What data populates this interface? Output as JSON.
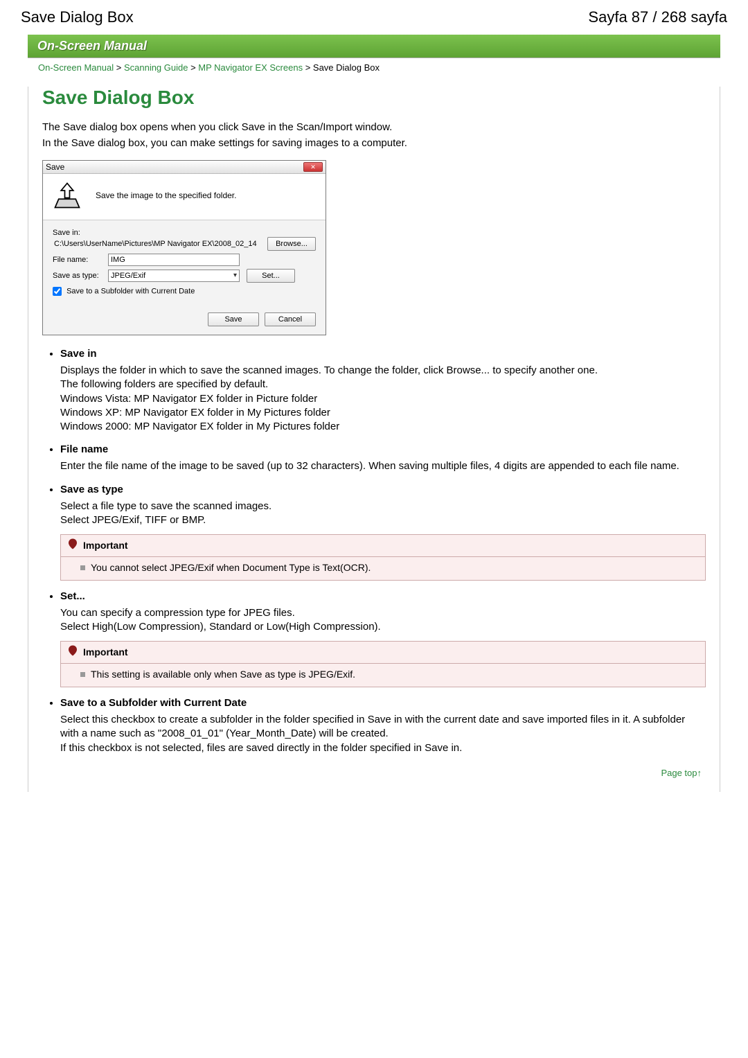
{
  "header": {
    "title_left": "Save Dialog Box",
    "title_right": "Sayfa 87 / 268 sayfa"
  },
  "strip": {
    "title": "On-Screen Manual"
  },
  "breadcrumb": {
    "a1": "On-Screen Manual",
    "a2": "Scanning Guide",
    "a3": "MP Navigator EX Screens",
    "current": "Save Dialog Box"
  },
  "page": {
    "h1": "Save Dialog Box",
    "intro1": "The Save dialog box opens when you click Save in the Scan/Import window.",
    "intro2": "In the Save dialog box, you can make settings for saving images to a computer."
  },
  "dialog": {
    "title": "Save",
    "close": "✕",
    "headline": "Save the image to the specified folder.",
    "savein_label": "Save in:",
    "savein_path": "C:\\Users\\UserName\\Pictures\\MP Navigator EX\\2008_02_14",
    "browse": "Browse...",
    "filename_label": "File name:",
    "filename_value": "IMG",
    "saveas_label": "Save as type:",
    "saveas_value": "JPEG/Exif",
    "set": "Set...",
    "checkbox_label": "Save to a Subfolder with Current Date",
    "save_btn": "Save",
    "cancel_btn": "Cancel"
  },
  "items": {
    "savein": {
      "title": "Save in",
      "p1": "Displays the folder in which to save the scanned images. To change the folder, click Browse... to specify another one.",
      "p2": "The following folders are specified by default.",
      "p3": "Windows Vista: MP Navigator EX folder in Picture folder",
      "p4": "Windows XP: MP Navigator EX folder in My Pictures folder",
      "p5": "Windows 2000: MP Navigator EX folder in My Pictures folder"
    },
    "filename": {
      "title": "File name",
      "p1": "Enter the file name of the image to be saved (up to 32 characters). When saving multiple files, 4 digits are appended to each file name."
    },
    "saveas": {
      "title": "Save as type",
      "p1": "Select a file type to save the scanned images.",
      "p2": "Select JPEG/Exif, TIFF or BMP.",
      "note_title": "Important",
      "note_body": "You cannot select JPEG/Exif when Document Type is Text(OCR)."
    },
    "set": {
      "title": "Set...",
      "p1": "You can specify a compression type for JPEG files.",
      "p2": "Select High(Low Compression), Standard or Low(High Compression).",
      "note_title": "Important",
      "note_body": "This setting is available only when Save as type is JPEG/Exif."
    },
    "subfolder": {
      "title": "Save to a Subfolder with Current Date",
      "p1": "Select this checkbox to create a subfolder in the folder specified in Save in with the current date and save imported files in it. A subfolder with a name such as \"2008_01_01\" (Year_Month_Date) will be created.",
      "p2": "If this checkbox is not selected, files are saved directly in the folder specified in Save in."
    }
  },
  "pagetop": "Page top"
}
